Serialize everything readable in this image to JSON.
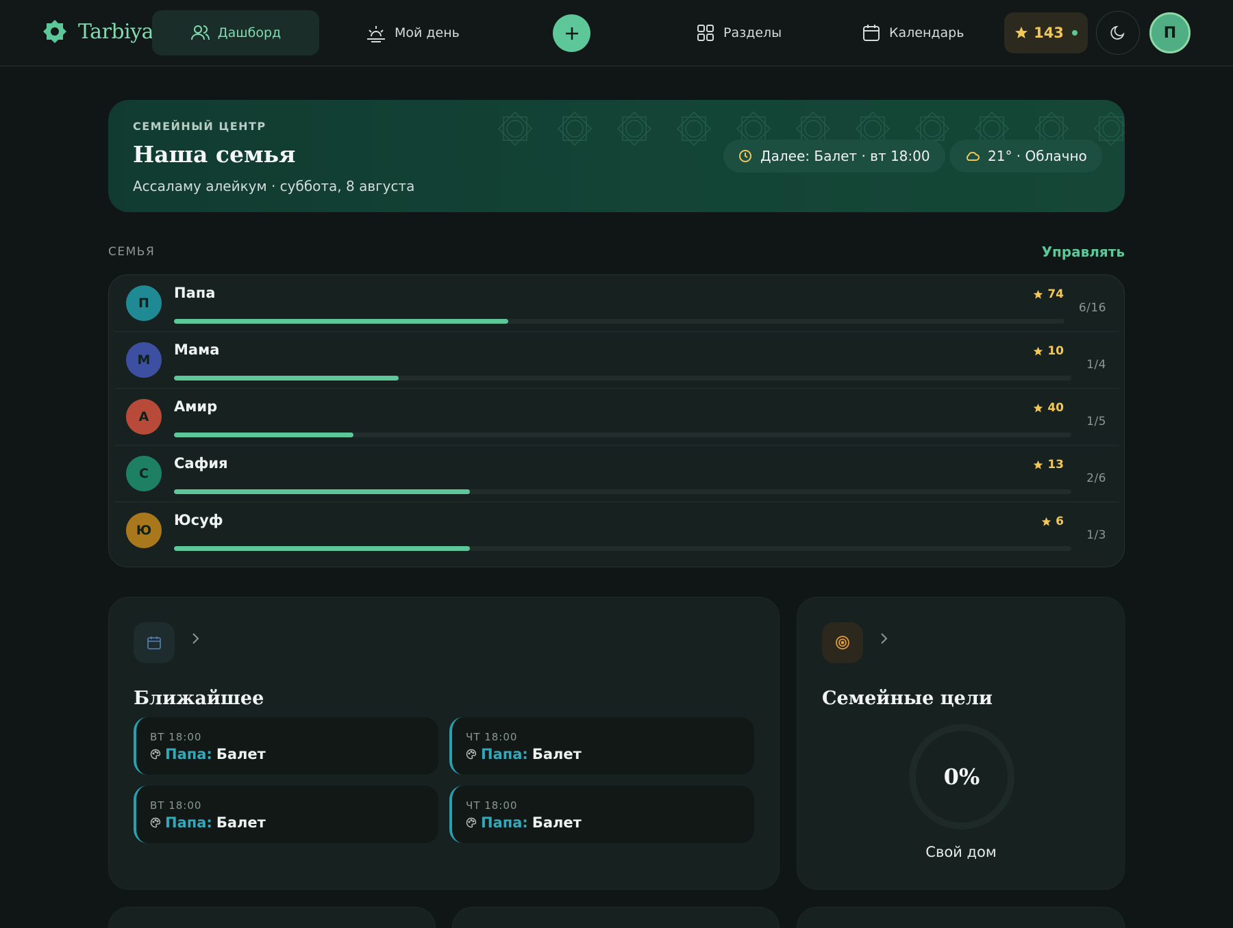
{
  "app": {
    "name": "Tarbiya"
  },
  "nav": {
    "dashboard": "Дашборд",
    "my_day": "Мой день",
    "sections": "Разделы",
    "calendar": "Календарь",
    "stars": "143",
    "user_initial": "П"
  },
  "hero": {
    "kicker": "СЕМЕЙНЫЙ ЦЕНТР",
    "title": "Наша семья",
    "subtitle": "Ассаламу алейкум · суббота, 8 августа",
    "next_event": "Далее: Балет · вт 18:00",
    "weather": "21° · Облачно"
  },
  "family": {
    "label": "СЕМЬЯ",
    "manage": "Управлять",
    "members": [
      {
        "initial": "П",
        "name": "Папа",
        "stars": "74",
        "ratio": "6/16",
        "progress": 0.375,
        "color": "#1f8a94"
      },
      {
        "initial": "М",
        "name": "Мама",
        "stars": "10",
        "ratio": "1/4",
        "progress": 0.25,
        "color": "#3d4fa0"
      },
      {
        "initial": "А",
        "name": "Амир",
        "stars": "40",
        "ratio": "1/5",
        "progress": 0.2,
        "color": "#b84a3a"
      },
      {
        "initial": "С",
        "name": "Сафия",
        "stars": "13",
        "ratio": "2/6",
        "progress": 0.33,
        "color": "#1e8062"
      },
      {
        "initial": "Ю",
        "name": "Юсуф",
        "stars": "6",
        "ratio": "1/3",
        "progress": 0.33,
        "color": "#a9781c"
      }
    ]
  },
  "upcoming": {
    "title": "Ближайшее",
    "events": [
      {
        "time": "ВТ 18:00",
        "who": "Папа:",
        "what": "Балет"
      },
      {
        "time": "ЧТ 18:00",
        "who": "Папа:",
        "what": "Балет"
      },
      {
        "time": "ВТ 18:00",
        "who": "Папа:",
        "what": "Балет"
      },
      {
        "time": "ЧТ 18:00",
        "who": "Папа:",
        "what": "Балет"
      }
    ]
  },
  "goals": {
    "title": "Семейные цели",
    "percent": "0%",
    "progress": 0,
    "goal_name": "Свой дом"
  },
  "colors": {
    "accent": "#5ec79a",
    "star": "#f2c75a",
    "event_who": "#33a8ba"
  }
}
